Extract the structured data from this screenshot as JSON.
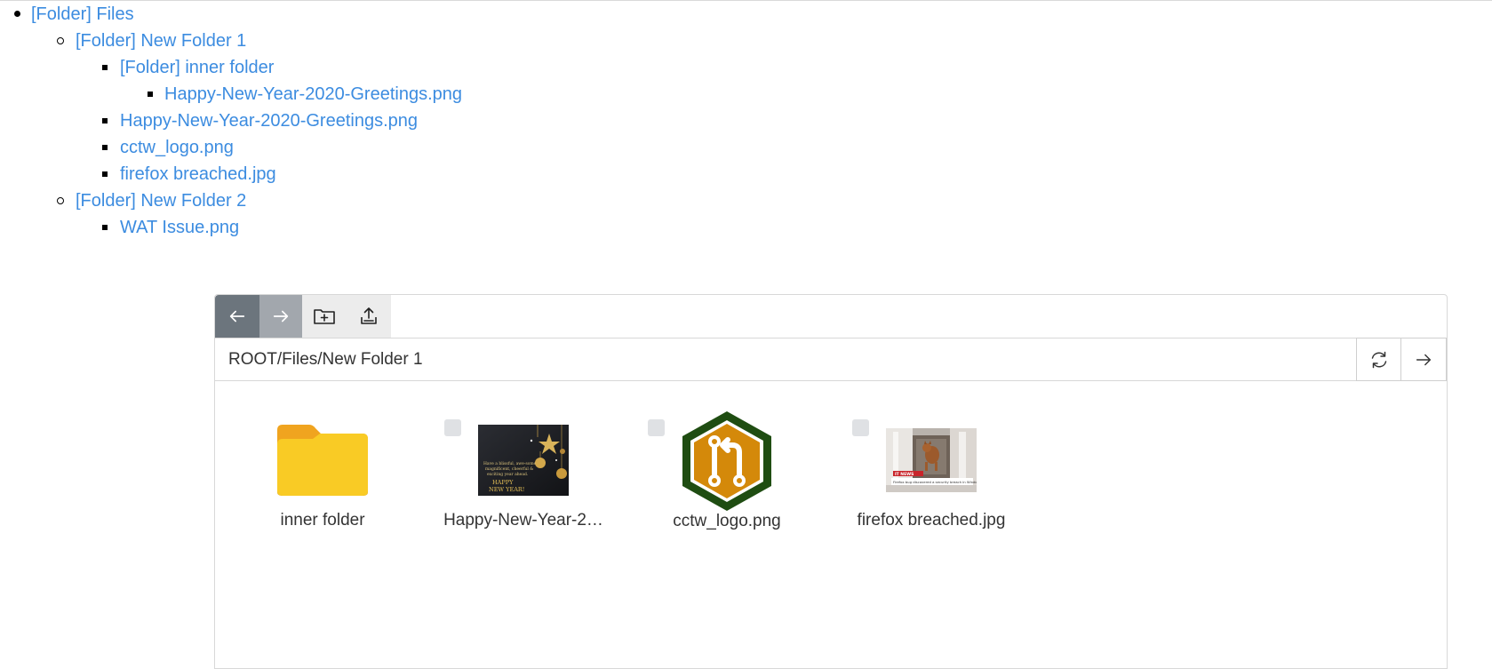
{
  "tree": {
    "root": "[Folder] Files",
    "folder1": "[Folder] New Folder 1",
    "inner_folder": "[Folder] inner folder",
    "inner_file": "Happy-New-Year-2020-Greetings.png",
    "f1_file1": "Happy-New-Year-2020-Greetings.png",
    "f1_file2": "cctw_logo.png",
    "f1_file3": "firefox breached.jpg",
    "folder2": "[Folder] New Folder 2",
    "f2_file1": "WAT Issue.png"
  },
  "file_manager": {
    "toolbar": {
      "back_icon": "arrow-left-icon",
      "forward_icon": "arrow-right-icon",
      "new_folder_icon": "folder-plus-icon",
      "upload_icon": "upload-icon"
    },
    "path": "ROOT/Files/New Folder 1",
    "path_actions": {
      "refresh_icon": "refresh-icon",
      "go_icon": "arrow-right-icon"
    },
    "items": [
      {
        "label": "inner folder",
        "type": "folder"
      },
      {
        "label": "Happy-New-Year-2…",
        "type": "image"
      },
      {
        "label": "cctw_logo.png",
        "type": "image"
      },
      {
        "label": "firefox breached.jpg",
        "type": "image"
      }
    ],
    "colors": {
      "link": "#3c8ce0",
      "toolbar_back": "#6c757d",
      "toolbar_forward": "#a2a7ad",
      "folder": "#f9c922",
      "cctw_green": "#1f4d12",
      "cctw_orange": "#d4890a"
    }
  }
}
